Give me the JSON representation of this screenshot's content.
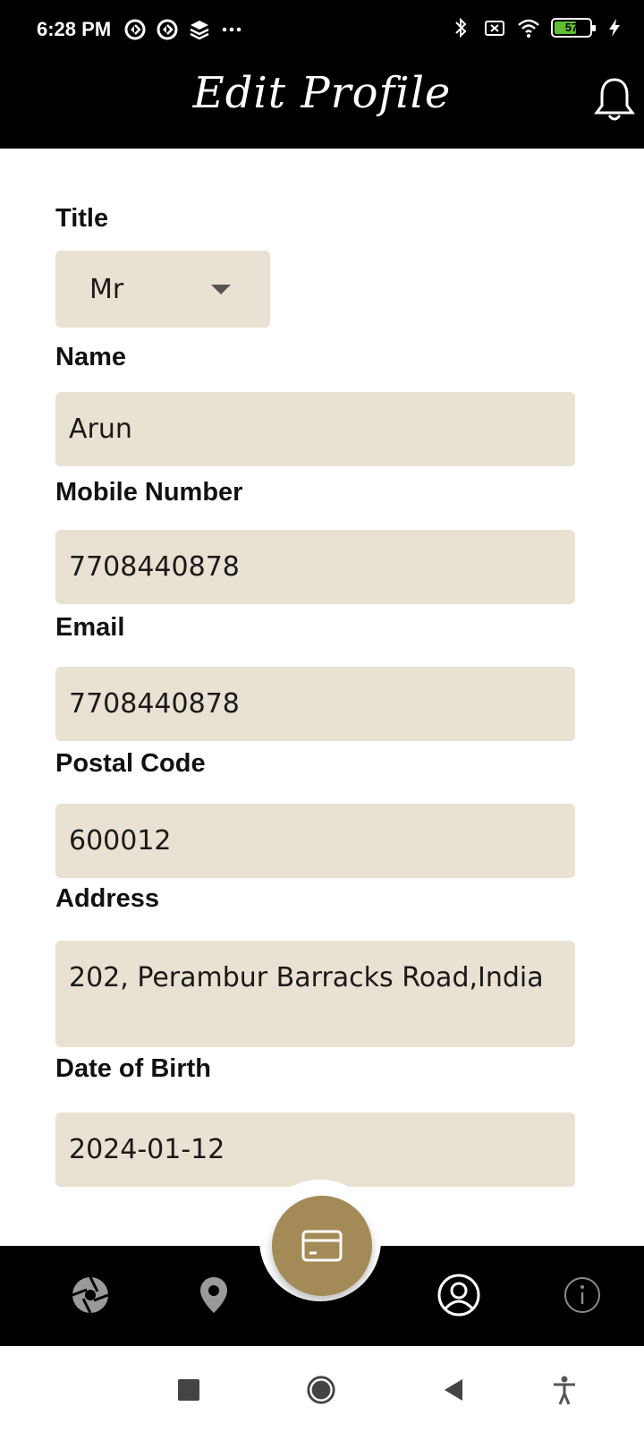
{
  "status_bar": {
    "time": "6:28 PM",
    "battery_level": "57",
    "icons_left": [
      "sync-icon",
      "sync-icon",
      "layers-icon",
      "more-dots-icon"
    ],
    "icons_right": [
      "bluetooth-icon",
      "no-sim-icon",
      "wifi-icon",
      "battery-icon",
      "charging-icon"
    ]
  },
  "header": {
    "title": "Edit Profile",
    "icon": "bell-icon"
  },
  "form": {
    "title": {
      "label": "Title",
      "value": "Mr"
    },
    "name": {
      "label": "Name",
      "value": "Arun"
    },
    "mobile": {
      "label": "Mobile Number",
      "value": "7708440878"
    },
    "email": {
      "label": "Email",
      "value": "7708440878"
    },
    "postal": {
      "label": "Postal Code",
      "value": "600012"
    },
    "address": {
      "label": "Address",
      "value": "202,  Perambur Barracks Road,India"
    },
    "dob": {
      "label": "Date of Birth",
      "value": "2024-01-12"
    }
  },
  "bottom_nav": {
    "items": [
      "aperture-icon",
      "location-pin-icon",
      "card-icon",
      "profile-icon",
      "info-icon"
    ],
    "active": "profile-icon",
    "fab_color": "#a38a57"
  },
  "colors": {
    "field_bg": "#e9e1d2",
    "header_bg": "#000000",
    "accent": "#a38a57"
  }
}
